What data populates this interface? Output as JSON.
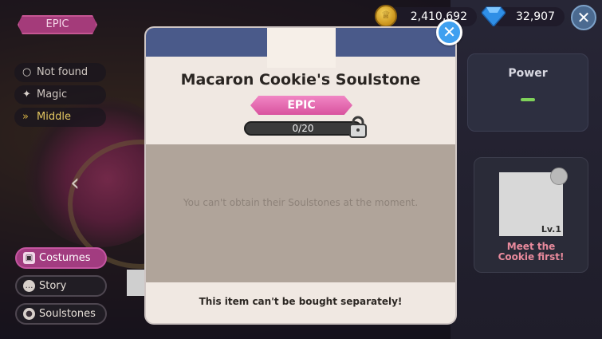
{
  "left_panel": {
    "rarity": "EPIC",
    "stats": [
      {
        "icon": "search-icon",
        "label": "Not found"
      },
      {
        "icon": "magic-wand-icon",
        "label": "Magic"
      },
      {
        "icon": "chevrons-right-icon",
        "label": "Middle"
      }
    ],
    "menu": [
      {
        "icon": "shirt-icon",
        "label": "Costumes",
        "active": true
      },
      {
        "icon": "speech-bubble-icon",
        "label": "Story",
        "active": false
      },
      {
        "icon": "soulstone-icon",
        "label": "Soulstones",
        "active": false
      }
    ]
  },
  "currency": {
    "coins": "2,410,692",
    "crystals": "32,907"
  },
  "power_panel": {
    "title": "Power"
  },
  "cookie_panel": {
    "level": "Lv.1",
    "message": "Meet the\nCookie first!"
  },
  "modal": {
    "title": "Macaron Cookie's Soulstone",
    "rarity": "EPIC",
    "progress": {
      "current": 0,
      "total": 20,
      "label": "0/20"
    },
    "body_message": "You can't obtain their Soulstones at the moment.",
    "footer_message": "This item can't be bought separately!"
  },
  "colors": {
    "modal_header": "#4a5a8a",
    "epic_pink": "#d9539f",
    "close_blue": "#3fa0f0",
    "power_green": "#7fd25a",
    "meet_text": "#e88a9c"
  }
}
